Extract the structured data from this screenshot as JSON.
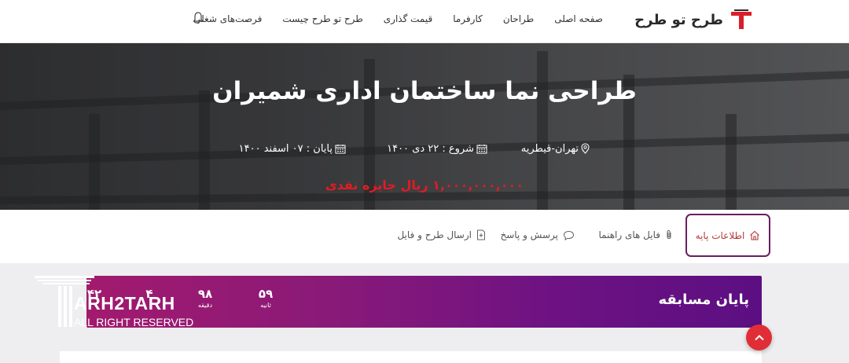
{
  "header": {
    "logo_text": "طرح تو طرح",
    "nav": [
      "صفحه اصلی",
      "طراحان",
      "کارفرما",
      "قیمت گذاری",
      "طرح تو طرح چیست",
      "فرصت‌های شغلی"
    ]
  },
  "hero": {
    "title": "طراحی نما ساختمان اداری شمیران",
    "location": "تهران-قیطریه",
    "start": "شروع : ۲۲ دی ۱۴۰۰",
    "end": "پایان : ۰۷ اسفند ۱۴۰۰",
    "prize": "۱,۰۰۰,۰۰۰,۰۰۰ ریال جایزه نقدی"
  },
  "tabs": {
    "info": "اطلاعات پایه",
    "guide": "فایل های راهنما",
    "qa": "پرسش و پاسخ",
    "send": "ارسال طرح و فایل"
  },
  "countdown": {
    "title": "پایان مسابقه",
    "seconds": "۵۹",
    "seconds_label": "ثانیه",
    "minutes": "۹۸",
    "minutes_label": "دقیقه",
    "hours": "۴",
    "days": "۴۲"
  },
  "watermark": {
    "text": "ARH2TARH",
    "sub": "ALL RIGHT RESERVED"
  },
  "colors": {
    "accent": "#e31b23",
    "brand_purple": "#6a1d63",
    "banner_start": "#a21a6e",
    "banner_end": "#5c0f82"
  }
}
